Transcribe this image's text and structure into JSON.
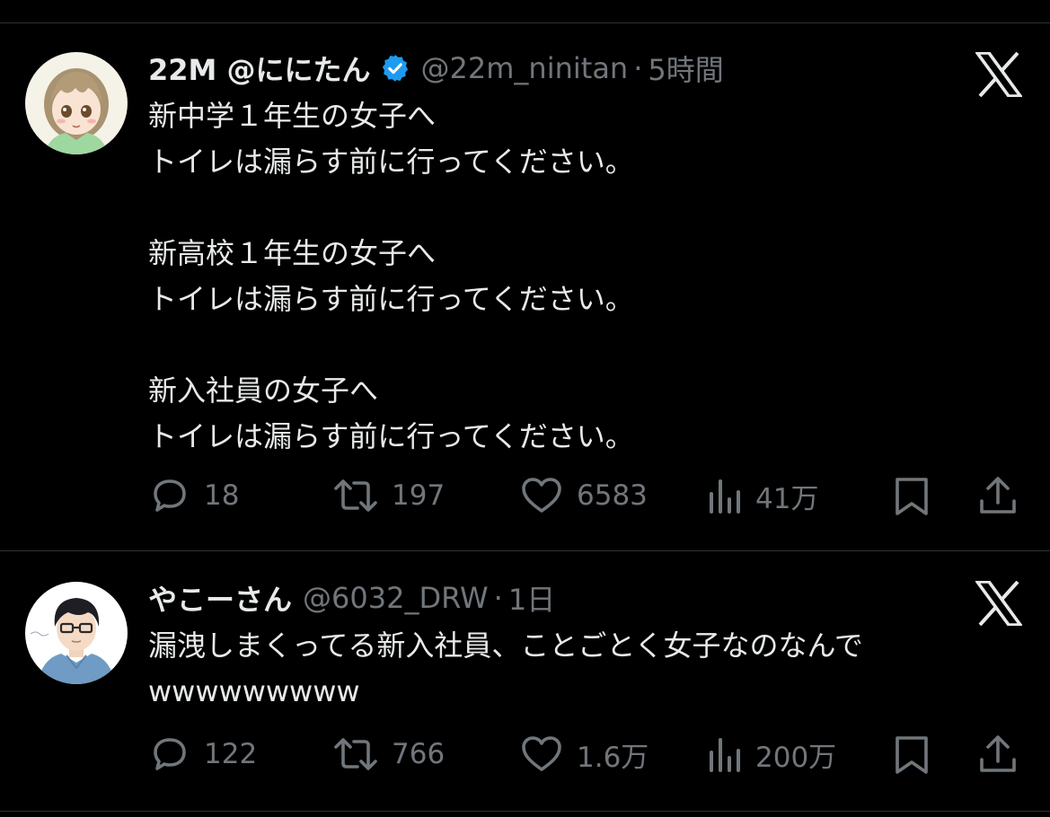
{
  "tweets": [
    {
      "display_name": "22M @ににたん",
      "verified": true,
      "handle": "@22m_ninitan",
      "separator": "·",
      "time": "5時間",
      "text": "新中学１年生の女子へ\nトイレは漏らす前に行ってください。\n\n新高校１年生の女子へ\nトイレは漏らす前に行ってください。\n\n新入社員の女子へ\nトイレは漏らす前に行ってください。",
      "replies": "18",
      "retweets": "197",
      "likes": "6583",
      "views": "41万"
    },
    {
      "display_name": "やこーさん",
      "verified": false,
      "handle": "@6032_DRW",
      "separator": "·",
      "time": "1日",
      "text": "漏洩しまくってる新入社員、ことごとく女子なのなんで\nwwwwwwwww",
      "replies": "122",
      "retweets": "766",
      "likes": "1.6万",
      "views": "200万"
    }
  ],
  "colors": {
    "background": "#000000",
    "primary_text": "#e7e9ea",
    "secondary_text": "#71767b",
    "divider": "#2f3336",
    "verified_badge": "#1d9bf0"
  },
  "icons": {
    "reply": "reply-icon",
    "retweet": "retweet-icon",
    "like": "heart-icon",
    "views": "views-icon",
    "bookmark": "bookmark-icon",
    "share": "share-icon",
    "platform": "x-logo-icon",
    "verified": "verified-badge-icon"
  }
}
